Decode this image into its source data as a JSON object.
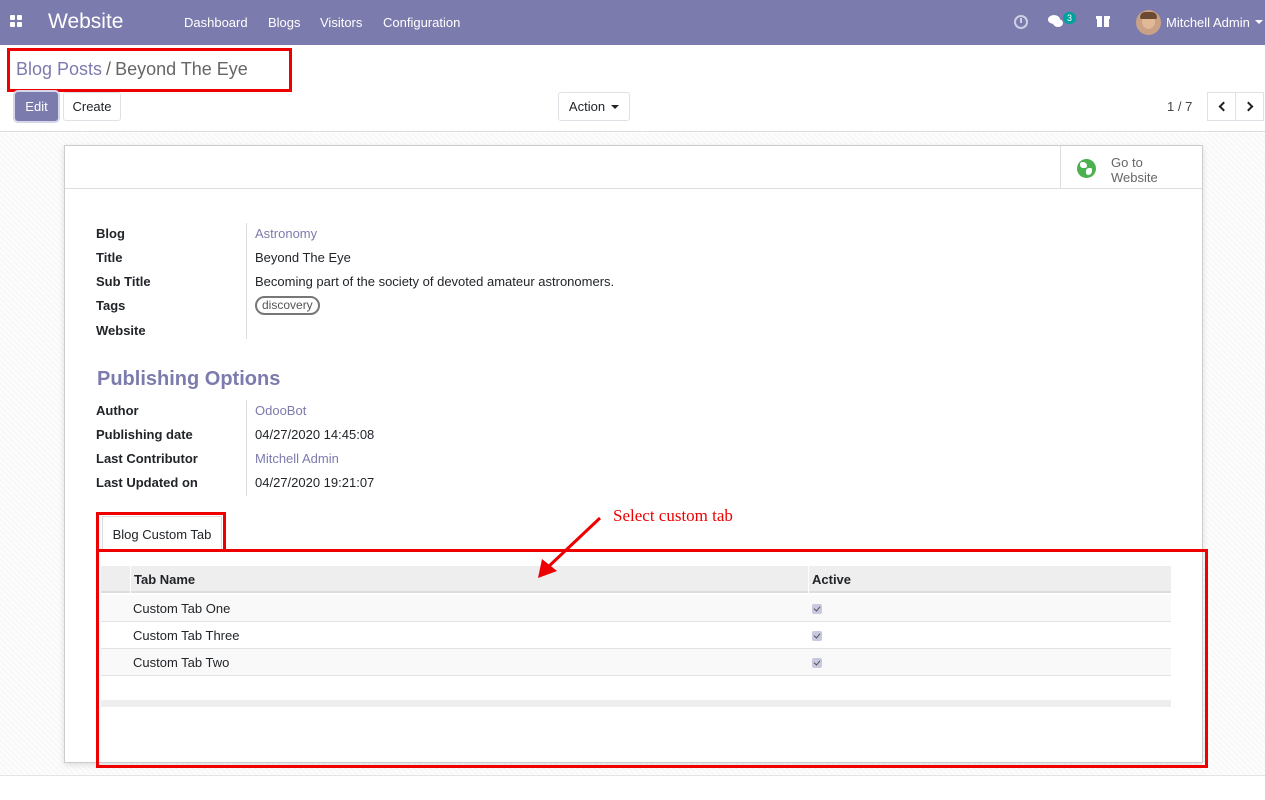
{
  "navbar": {
    "app_title": "Website",
    "menu": [
      "Dashboard",
      "Blogs",
      "Visitors",
      "Configuration"
    ],
    "messages_badge": "3",
    "user_name": "Mitchell Admin",
    "accent_color": "#7c7bad"
  },
  "breadcrumb": {
    "parent": "Blog Posts",
    "separator": "/",
    "current": "Beyond The Eye"
  },
  "buttons": {
    "edit": "Edit",
    "create": "Create",
    "action": "Action"
  },
  "pager": {
    "text": "1 / 7"
  },
  "smart_button": {
    "line1": "Go to",
    "line2": "Website"
  },
  "fields": {
    "blog_label": "Blog",
    "blog_value": "Astronomy",
    "title_label": "Title",
    "title_value": "Beyond The Eye",
    "subtitle_label": "Sub Title",
    "subtitle_value": "Becoming part of the society of devoted amateur astronomers.",
    "tags_label": "Tags",
    "tag": "discovery",
    "website_label": "Website",
    "website_value": ""
  },
  "publishing": {
    "section_title": "Publishing Options",
    "author_label": "Author",
    "author_value": "OdooBot",
    "date_label": "Publishing date",
    "date_value": "04/27/2020 14:45:08",
    "contributor_label": "Last Contributor",
    "contributor_value": "Mitchell Admin",
    "updated_label": "Last Updated on",
    "updated_value": "04/27/2020 19:21:07"
  },
  "tabs": {
    "active": "Blog Custom Tab"
  },
  "table": {
    "columns": [
      "Tab Name",
      "Active"
    ],
    "rows": [
      {
        "name": "Custom Tab One",
        "active": true
      },
      {
        "name": "Custom Tab Three",
        "active": true
      },
      {
        "name": "Custom Tab Two",
        "active": true
      }
    ]
  },
  "annotation": {
    "text": "Select custom tab",
    "color": "#ee0000"
  }
}
